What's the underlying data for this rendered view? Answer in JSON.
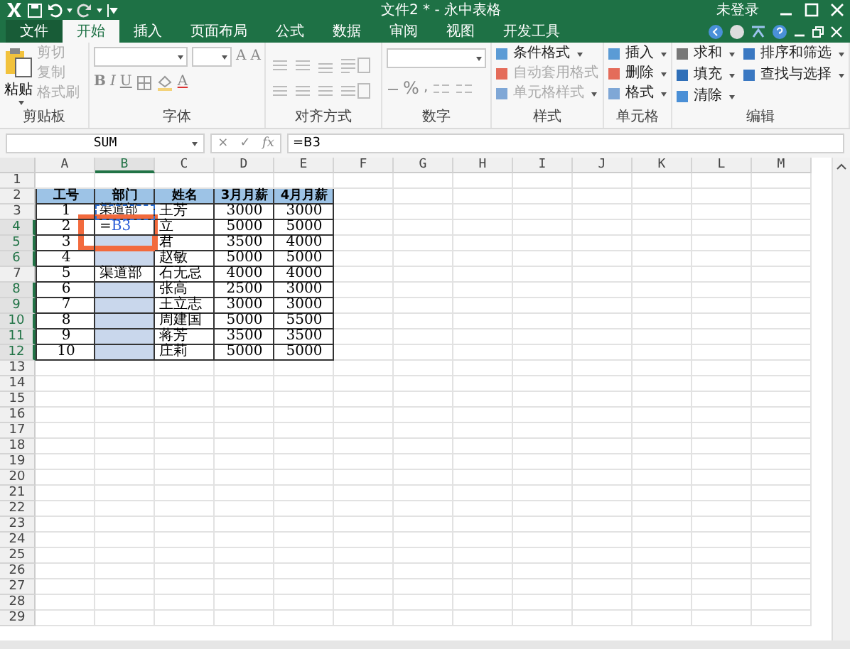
{
  "window": {
    "title": "文件2 * - 永中表格",
    "account": "未登录"
  },
  "tabs": [
    {
      "label": "文件",
      "selected": false,
      "kind": "file"
    },
    {
      "label": "开始",
      "selected": true,
      "kind": "tab"
    },
    {
      "label": "插入",
      "selected": false,
      "kind": "tab"
    },
    {
      "label": "页面布局",
      "selected": false,
      "kind": "tab"
    },
    {
      "label": "公式",
      "selected": false,
      "kind": "tab"
    },
    {
      "label": "数据",
      "selected": false,
      "kind": "tab"
    },
    {
      "label": "审阅",
      "selected": false,
      "kind": "tab"
    },
    {
      "label": "视图",
      "selected": false,
      "kind": "tab"
    },
    {
      "label": "开发工具",
      "selected": false,
      "kind": "tab"
    }
  ],
  "ribbon": {
    "groups": [
      {
        "label": "剪贴板",
        "kind": "clipboard",
        "big": "粘贴",
        "items": [
          {
            "label": "剪切",
            "disabled": true
          },
          {
            "label": "复制",
            "disabled": true
          },
          {
            "label": "格式刷",
            "disabled": true
          }
        ]
      },
      {
        "label": "字体",
        "kind": "font",
        "size_buttons": [
          "A",
          "A"
        ],
        "buttons": [
          "B",
          "I",
          "U"
        ],
        "color_button": "A"
      },
      {
        "label": "对齐方式",
        "kind": "align"
      },
      {
        "label": "数字",
        "kind": "number",
        "symbols": [
          "%",
          ","
        ]
      },
      {
        "label": "样式",
        "kind": "list",
        "items": [
          {
            "label": "条件格式",
            "dropdown": true,
            "disabled": false
          },
          {
            "label": "自动套用格式",
            "dropdown": false,
            "disabled": true
          },
          {
            "label": "单元格样式",
            "dropdown": true,
            "disabled": true
          }
        ]
      },
      {
        "label": "单元格",
        "kind": "list",
        "items": [
          {
            "label": "插入",
            "dropdown": true,
            "disabled": false
          },
          {
            "label": "删除",
            "dropdown": true,
            "disabled": false
          },
          {
            "label": "格式",
            "dropdown": true,
            "disabled": false
          }
        ]
      },
      {
        "label": "编辑",
        "kind": "grid",
        "items": [
          {
            "label": "求和",
            "dropdown": true,
            "disabled": false
          },
          {
            "label": "排序和筛选",
            "dropdown": true,
            "disabled": false
          },
          {
            "label": "填充",
            "dropdown": true,
            "disabled": false
          },
          {
            "label": "查找与选择",
            "dropdown": true,
            "disabled": false
          },
          {
            "label": "清除",
            "dropdown": true,
            "disabled": false
          }
        ]
      }
    ]
  },
  "formula_bar": {
    "name_box": "SUM",
    "cancel": "×",
    "enter": "✓",
    "fx": "fx",
    "value": "=B3"
  },
  "sheet": {
    "columns": [
      {
        "label": "A",
        "selected": false
      },
      {
        "label": "B",
        "selected": true
      },
      {
        "label": "C",
        "selected": false
      },
      {
        "label": "D",
        "selected": false
      },
      {
        "label": "E",
        "selected": false
      },
      {
        "label": "F",
        "selected": false
      },
      {
        "label": "G",
        "selected": false
      },
      {
        "label": "H",
        "selected": false
      },
      {
        "label": "I",
        "selected": false
      },
      {
        "label": "J",
        "selected": false
      },
      {
        "label": "K",
        "selected": false
      },
      {
        "label": "L",
        "selected": false
      },
      {
        "label": "M",
        "selected": false
      }
    ],
    "rows": [
      {
        "label": "1",
        "selected": false,
        "kind": "empty",
        "cells": []
      },
      {
        "label": "2",
        "selected": false,
        "kind": "header",
        "cells": [
          "工号",
          "部门",
          "姓名",
          "3月月薪",
          "4月月薪"
        ]
      },
      {
        "label": "3",
        "selected": false,
        "kind": "data",
        "cells": [
          "1",
          {
            "text": "渠道部",
            "copied": true
          },
          "王芳",
          "3000",
          "3000"
        ]
      },
      {
        "label": "4",
        "selected": true,
        "kind": "data",
        "cells": [
          "2",
          {
            "text": "=B3",
            "editing": true
          },
          "立",
          "5000",
          "5000"
        ]
      },
      {
        "label": "5",
        "selected": true,
        "kind": "data",
        "cells": [
          "3",
          "",
          "君",
          "3500",
          "4000"
        ]
      },
      {
        "label": "6",
        "selected": true,
        "kind": "data",
        "cells": [
          "4",
          "",
          "赵敏",
          "5000",
          "5000"
        ]
      },
      {
        "label": "7",
        "selected": false,
        "kind": "data",
        "cells": [
          "5",
          "渠道部",
          "石无忌",
          "4000",
          "4000"
        ]
      },
      {
        "label": "8",
        "selected": true,
        "kind": "data",
        "cells": [
          "6",
          "",
          "张高",
          "2500",
          "3000"
        ]
      },
      {
        "label": "9",
        "selected": true,
        "kind": "data",
        "cells": [
          "7",
          "",
          "王立志",
          "3000",
          "3000"
        ]
      },
      {
        "label": "10",
        "selected": true,
        "kind": "data",
        "cells": [
          "8",
          "",
          "周建国",
          "5000",
          "5500"
        ]
      },
      {
        "label": "11",
        "selected": true,
        "kind": "data",
        "cells": [
          "9",
          "",
          "蒋芳",
          "3500",
          "3500"
        ]
      },
      {
        "label": "12",
        "selected": true,
        "kind": "data",
        "cells": [
          "10",
          "",
          "庄莉",
          "5000",
          "5000"
        ]
      },
      {
        "label": "13",
        "selected": false,
        "kind": "empty",
        "cells": []
      },
      {
        "label": "14",
        "selected": false,
        "kind": "empty",
        "cells": []
      },
      {
        "label": "15",
        "selected": false,
        "kind": "empty",
        "cells": []
      },
      {
        "label": "16",
        "selected": false,
        "kind": "empty",
        "cells": []
      },
      {
        "label": "17",
        "selected": false,
        "kind": "empty",
        "cells": []
      },
      {
        "label": "18",
        "selected": false,
        "kind": "empty",
        "cells": []
      },
      {
        "label": "19",
        "selected": false,
        "kind": "empty",
        "cells": []
      },
      {
        "label": "20",
        "selected": false,
        "kind": "empty",
        "cells": []
      },
      {
        "label": "21",
        "selected": false,
        "kind": "empty",
        "cells": []
      },
      {
        "label": "22",
        "selected": false,
        "kind": "empty",
        "cells": []
      },
      {
        "label": "23",
        "selected": false,
        "kind": "empty",
        "cells": []
      },
      {
        "label": "24",
        "selected": false,
        "kind": "empty",
        "cells": []
      },
      {
        "label": "25",
        "selected": false,
        "kind": "empty",
        "cells": []
      },
      {
        "label": "26",
        "selected": false,
        "kind": "empty",
        "cells": []
      },
      {
        "label": "27",
        "selected": false,
        "kind": "empty",
        "cells": []
      },
      {
        "label": "28",
        "selected": false,
        "kind": "empty",
        "cells": []
      },
      {
        "label": "29",
        "selected": false,
        "kind": "empty",
        "cells": []
      }
    ]
  }
}
